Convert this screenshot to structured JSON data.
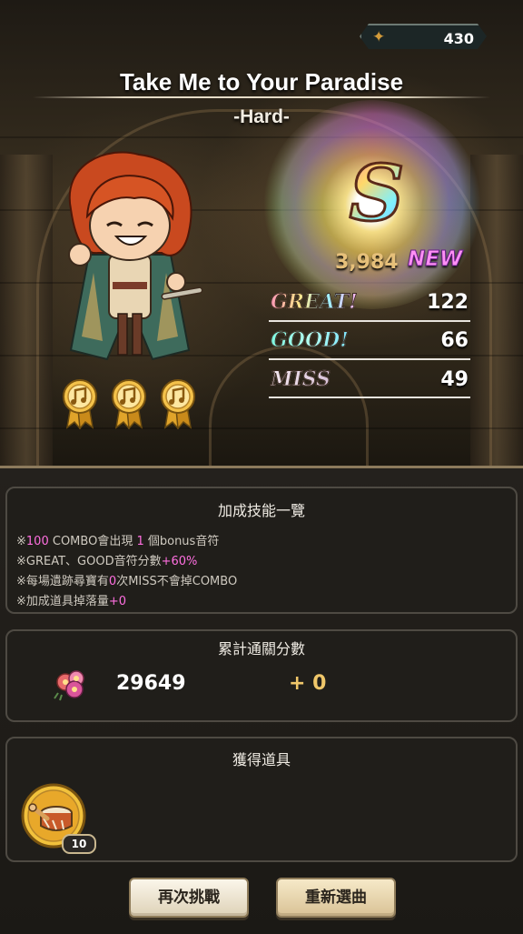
{
  "currency": {
    "icon": "drum-currency-icon",
    "value": "430"
  },
  "song": {
    "title": "Take Me to Your Paradise",
    "difficulty": "-Hard-"
  },
  "character": {
    "icon": "chibi-character"
  },
  "medals": [
    "music-note-medal-icon",
    "music-note-medal-icon",
    "music-note-medal-icon"
  ],
  "result": {
    "rank": "S",
    "score": "3,984",
    "new_label": "NEW",
    "stats": [
      {
        "label": "GREAT!",
        "value": "122"
      },
      {
        "label": "GOOD!",
        "value": "66"
      },
      {
        "label": "MISS",
        "value": "49"
      }
    ]
  },
  "bonus_panel": {
    "title": "加成技能一覽",
    "lines": [
      {
        "parts": [
          "※",
          "100",
          " COMBO會出現 ",
          "1",
          " 個bonus音符"
        ]
      },
      {
        "parts": [
          "※GREAT、GOOD音符分數",
          "+60%",
          ""
        ]
      },
      {
        "parts": [
          "※每場遺跡尋寶有",
          "0",
          "次MISS不會掉COMBO"
        ]
      },
      {
        "parts": [
          "※加成道具掉落量",
          "+0",
          ""
        ]
      }
    ]
  },
  "cumulative_panel": {
    "title": "累計通關分數",
    "total": "29649",
    "added": "+ 0"
  },
  "items_panel": {
    "title": "獲得道具",
    "items": [
      {
        "icon": "drum-item-icon",
        "count": "10"
      }
    ]
  },
  "buttons": {
    "retry": "再次挑戰",
    "reselect": "重新選曲"
  },
  "colors": {
    "highlight": "#ff6fe0",
    "panel_border": "#4e4a43",
    "accent_gold": "#f0c76a"
  }
}
